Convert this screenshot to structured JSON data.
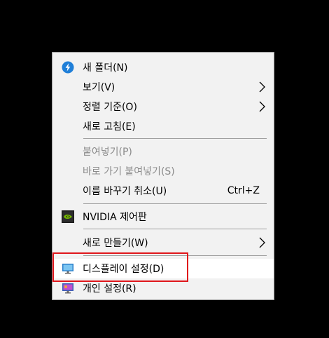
{
  "menu": {
    "items": [
      {
        "label": "새 폴더(N)",
        "icon": "new-folder-icon"
      },
      {
        "label": "보기(V)",
        "submenu": true
      },
      {
        "label": "정렬 기준(O)",
        "submenu": true
      },
      {
        "label": "새로 고침(E)"
      },
      {
        "label": "붙여넣기(P)",
        "disabled": true
      },
      {
        "label": "바로 가기 붙여넣기(S)",
        "disabled": true
      },
      {
        "label": "이름 바꾸기 취소(U)",
        "shortcut": "Ctrl+Z"
      },
      {
        "label": "NVIDIA 제어판",
        "icon": "nvidia-icon"
      },
      {
        "label": "새로 만들기(W)",
        "submenu": true
      },
      {
        "label": "디스플레이 설정(D)",
        "icon": "display-icon",
        "highlighted": true
      },
      {
        "label": "개인 설정(R)",
        "icon": "personalize-icon"
      }
    ]
  },
  "colors": {
    "menu_background": "#f2f2f2",
    "disabled_text": "#8a8a8a",
    "highlight_outline": "#e0161b",
    "hover_background": "#ffffff"
  }
}
